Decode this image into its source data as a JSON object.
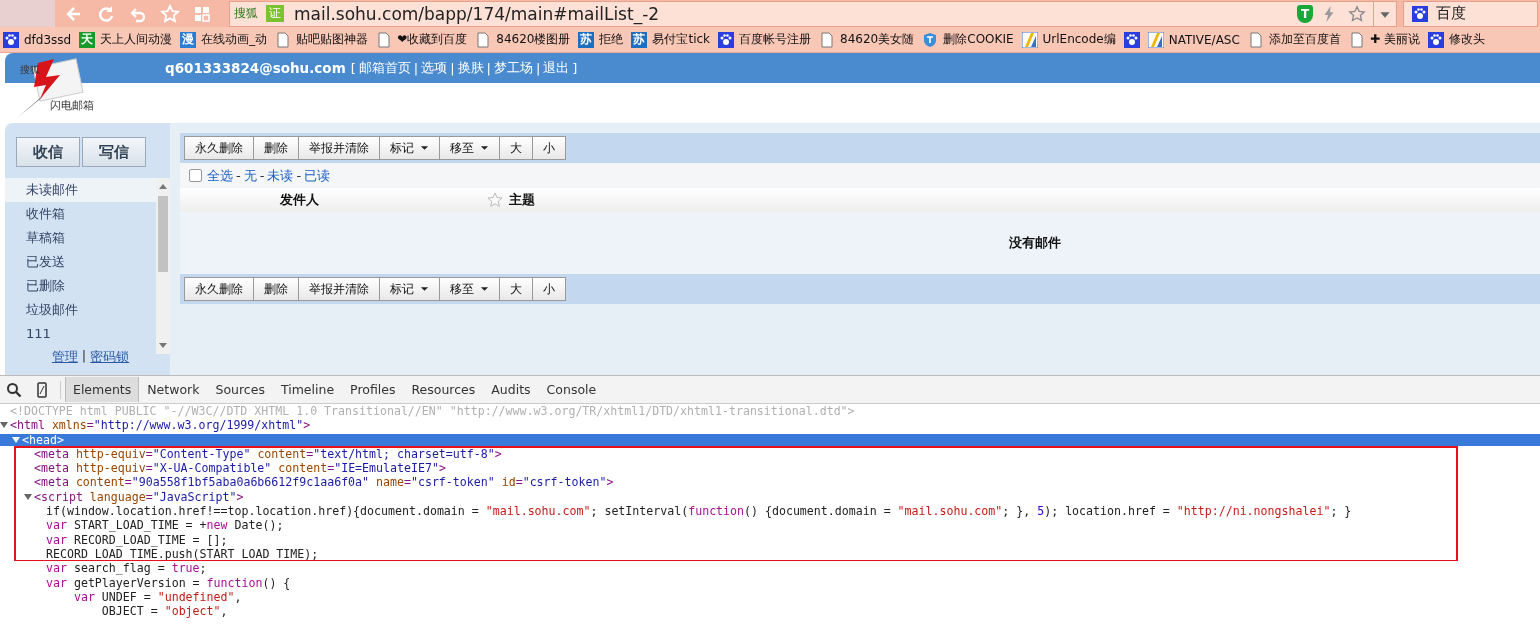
{
  "browser": {
    "nav_icons": [
      {
        "kind": "back"
      },
      {
        "kind": "refresh"
      },
      {
        "kind": "undo"
      },
      {
        "kind": "star"
      },
      {
        "kind": "grid"
      }
    ],
    "address": {
      "site_badge": "搜狐",
      "cert_badge": "证",
      "url": "mail.sohu.com/bapp/174/main#mailList_-2"
    },
    "right_icons": [
      {
        "kind": "shield",
        "glyph": "T"
      },
      {
        "kind": "bolt"
      },
      {
        "kind": "star"
      },
      {
        "kind": "dropdown"
      }
    ],
    "search": {
      "value": "百度"
    }
  },
  "bookmarks": [
    {
      "kind": "paw",
      "label": "dfd3ssd"
    },
    {
      "kind": "glyph",
      "glyph": "天",
      "color": "#1a9a2a",
      "label": "天上人间动漫"
    },
    {
      "kind": "glyph",
      "glyph": "漫",
      "color": "#2b7cd3",
      "label": "在线动画_动"
    },
    {
      "kind": "page",
      "label": "贴吧贴图神器"
    },
    {
      "kind": "page",
      "label": "❤收藏到百度"
    },
    {
      "kind": "page",
      "label": "84620楼图册"
    },
    {
      "kind": "glyph",
      "glyph": "苏",
      "color": "#1f6fc0",
      "label": "拒绝"
    },
    {
      "kind": "glyph",
      "glyph": "苏",
      "color": "#1f6fc0",
      "label": "易付宝tick"
    },
    {
      "kind": "paw",
      "label": "百度帐号注册"
    },
    {
      "kind": "page",
      "label": "84620美女随"
    },
    {
      "kind": "shield",
      "label": "删除COOKIE"
    },
    {
      "kind": "flag",
      "label": "UrlEncode编"
    },
    {
      "kind": "paw"
    },
    {
      "kind": "flag",
      "label": "NATIVE/ASC"
    },
    {
      "kind": "page",
      "label": "添加至百度首"
    },
    {
      "kind": "page",
      "label": "✚ 美丽说"
    },
    {
      "kind": "paw",
      "label": "修改头"
    }
  ],
  "mail": {
    "logo": {
      "brand": "搜狐",
      "name": "闪电邮箱"
    },
    "header": {
      "user": "q601333824@sohu.com",
      "open": "[",
      "close": "]",
      "separator": "|",
      "links": [
        "邮箱首页",
        "选项",
        "换肤",
        "梦工场",
        "退出"
      ]
    },
    "compose_buttons": [
      "收信",
      "写信"
    ],
    "folders": [
      {
        "label": "未读邮件",
        "selected": true
      },
      {
        "label": "收件箱",
        "selected": false
      },
      {
        "label": "草稿箱",
        "selected": false
      },
      {
        "label": "已发送",
        "selected": false
      },
      {
        "label": "已删除",
        "selected": false
      },
      {
        "label": "垃圾邮件",
        "selected": false
      },
      {
        "label": "111",
        "selected": false
      }
    ],
    "sidebar_footer": {
      "links": [
        "管理",
        "密码锁"
      ],
      "separator": "|"
    },
    "toolbar_top": [
      {
        "label": "永久删除",
        "kind": "plain"
      },
      {
        "label": "删除",
        "kind": "plain"
      },
      {
        "label": "举报并清除",
        "kind": "plain"
      },
      {
        "label": "标记",
        "kind": "dropdown"
      },
      {
        "label": "移至",
        "kind": "dropdown"
      },
      {
        "label": "大",
        "kind": "plain"
      },
      {
        "label": "小",
        "kind": "plain"
      }
    ],
    "select_row": {
      "checked": false,
      "links": [
        "全选",
        "无",
        "未读",
        "已读"
      ],
      "separator": "-"
    },
    "columns": [
      "发件人",
      "主题"
    ],
    "empty_message": "没有邮件",
    "toolbar_bottom": [
      {
        "label": "永久删除",
        "kind": "plain"
      },
      {
        "label": "删除",
        "kind": "plain"
      },
      {
        "label": "举报并清除",
        "kind": "plain"
      },
      {
        "label": "标记",
        "kind": "dropdown"
      },
      {
        "label": "移至",
        "kind": "dropdown"
      },
      {
        "label": "大",
        "kind": "plain"
      },
      {
        "label": "小",
        "kind": "plain"
      }
    ]
  },
  "devtools": {
    "tabs": [
      {
        "label": "Elements",
        "selected": true
      },
      {
        "label": "Network",
        "selected": false
      },
      {
        "label": "Sources",
        "selected": false
      },
      {
        "label": "Timeline",
        "selected": false
      },
      {
        "label": "Profiles",
        "selected": false
      },
      {
        "label": "Resources",
        "selected": false
      },
      {
        "label": "Audits",
        "selected": false
      },
      {
        "label": "Console",
        "selected": false
      }
    ],
    "tree": [
      {
        "segments": [
          {
            "kind": "doc",
            "text": "<!DOCTYPE html PUBLIC \"-//W3C//DTD XHTML 1.0 Transitional//EN\" \"http://www.w3.org/TR/xhtml1/DTD/xhtml1-transitional.dtd\">"
          }
        ]
      },
      {
        "segments": [
          {
            "kind": "tag",
            "text": "<html"
          },
          {
            "kind": "attr",
            "text": " xmlns"
          },
          {
            "kind": "tag",
            "text": "="
          },
          {
            "kind": "val",
            "text": "\"http://www.w3.org/1999/xhtml\""
          },
          {
            "kind": "tag",
            "text": ">"
          }
        ],
        "expanded": true,
        "selected": false,
        "children": [
          {
            "segments": [
              {
                "text": "<head>"
              }
            ],
            "expanded": true,
            "selected": true,
            "children": [
              {
                "segments": [
                  {
                    "kind": "tag",
                    "text": "<meta"
                  },
                  {
                    "kind": "attr",
                    "text": " http-equiv"
                  },
                  {
                    "kind": "tag",
                    "text": "="
                  },
                  {
                    "kind": "val",
                    "text": "\"Content-Type\""
                  },
                  {
                    "kind": "attr",
                    "text": " content"
                  },
                  {
                    "kind": "tag",
                    "text": "="
                  },
                  {
                    "kind": "val",
                    "text": "\"text/html; charset=utf-8\""
                  },
                  {
                    "kind": "tag",
                    "text": ">"
                  }
                ]
              },
              {
                "segments": [
                  {
                    "kind": "tag",
                    "text": "<meta"
                  },
                  {
                    "kind": "attr",
                    "text": " http-equiv"
                  },
                  {
                    "kind": "tag",
                    "text": "="
                  },
                  {
                    "kind": "val",
                    "text": "\"X-UA-Compatible\""
                  },
                  {
                    "kind": "attr",
                    "text": " content"
                  },
                  {
                    "kind": "tag",
                    "text": "="
                  },
                  {
                    "kind": "val",
                    "text": "\"IE=EmulateIE7\""
                  },
                  {
                    "kind": "tag",
                    "text": ">"
                  }
                ]
              },
              {
                "segments": [
                  {
                    "kind": "tag",
                    "text": "<meta"
                  },
                  {
                    "kind": "attr",
                    "text": " content"
                  },
                  {
                    "kind": "tag",
                    "text": "="
                  },
                  {
                    "kind": "val",
                    "text": "\"90a558f1bf5aba0a6b6612f9c1aa6f0a\""
                  },
                  {
                    "kind": "attr",
                    "text": " name"
                  },
                  {
                    "kind": "tag",
                    "text": "="
                  },
                  {
                    "kind": "val",
                    "text": "\"csrf-token\""
                  },
                  {
                    "kind": "attr",
                    "text": " id"
                  },
                  {
                    "kind": "tag",
                    "text": "="
                  },
                  {
                    "kind": "val",
                    "text": "\"csrf-token\""
                  },
                  {
                    "kind": "tag",
                    "text": ">"
                  }
                ]
              },
              {
                "segments": [
                  {
                    "kind": "tag",
                    "text": "<script"
                  },
                  {
                    "kind": "attr",
                    "text": " language"
                  },
                  {
                    "kind": "tag",
                    "text": "="
                  },
                  {
                    "kind": "val",
                    "text": "\"JavaScript\""
                  },
                  {
                    "kind": "tag",
                    "text": ">"
                  }
                ],
                "expanded": true,
                "selected": false,
                "children": [
                  {
                    "segments": [
                      {
                        "kind": "plain",
                        "text": "if(window.location.href!==top.location.href){document.domain = "
                      },
                      {
                        "kind": "str",
                        "text": "\"mail.sohu.com\""
                      },
                      {
                        "kind": "plain",
                        "text": "; setInterval("
                      },
                      {
                        "kind": "kw",
                        "text": "function"
                      },
                      {
                        "kind": "plain",
                        "text": "() {document.domain = "
                      },
                      {
                        "kind": "str",
                        "text": "\"mail.sohu.com\""
                      },
                      {
                        "kind": "plain",
                        "text": "; }, "
                      },
                      {
                        "kind": "num",
                        "text": "5"
                      },
                      {
                        "kind": "plain",
                        "text": "); location.href = "
                      },
                      {
                        "kind": "str",
                        "text": "\"http://ni.nongshalei\""
                      },
                      {
                        "kind": "plain",
                        "text": "; }"
                      }
                    ]
                  },
                  {
                    "segments": [
                      {
                        "kind": "kw",
                        "text": "var"
                      },
                      {
                        "kind": "plain",
                        "text": " START_LOAD_TIME = +"
                      },
                      {
                        "kind": "kw",
                        "text": "new"
                      },
                      {
                        "kind": "plain",
                        "text": " Date();"
                      }
                    ]
                  },
                  {
                    "segments": [
                      {
                        "kind": "kw",
                        "text": "var"
                      },
                      {
                        "kind": "plain",
                        "text": " RECORD_LOAD_TIME = [];"
                      }
                    ]
                  },
                  {
                    "segments": [
                      {
                        "kind": "plain",
                        "text": "RECORD_LOAD_TIME.push(START_LOAD_TIME);"
                      }
                    ]
                  },
                  {
                    "segments": [
                      {
                        "kind": "kw",
                        "text": "var"
                      },
                      {
                        "kind": "plain",
                        "text": " search_flag = "
                      },
                      {
                        "kind": "kw",
                        "text": "true"
                      },
                      {
                        "kind": "plain",
                        "text": ";"
                      }
                    ]
                  },
                  {
                    "segments": [
                      {
                        "kind": "kw",
                        "text": "var"
                      },
                      {
                        "kind": "plain",
                        "text": " getPlayerVersion = "
                      },
                      {
                        "kind": "kw",
                        "text": "function"
                      },
                      {
                        "kind": "plain",
                        "text": "() {"
                      }
                    ]
                  },
                  {
                    "segments": [
                      {
                        "kind": "kw",
                        "text": "    var"
                      },
                      {
                        "kind": "plain",
                        "text": " UNDEF = "
                      },
                      {
                        "kind": "str",
                        "text": "\"undefined\""
                      },
                      {
                        "kind": "plain",
                        "text": ","
                      }
                    ]
                  },
                  {
                    "segments": [
                      {
                        "kind": "plain",
                        "text": "        OBJECT = "
                      },
                      {
                        "kind": "str",
                        "text": "\"object\""
                      },
                      {
                        "kind": "plain",
                        "text": ","
                      }
                    ]
                  }
                ]
              }
            ]
          }
        ]
      }
    ]
  }
}
